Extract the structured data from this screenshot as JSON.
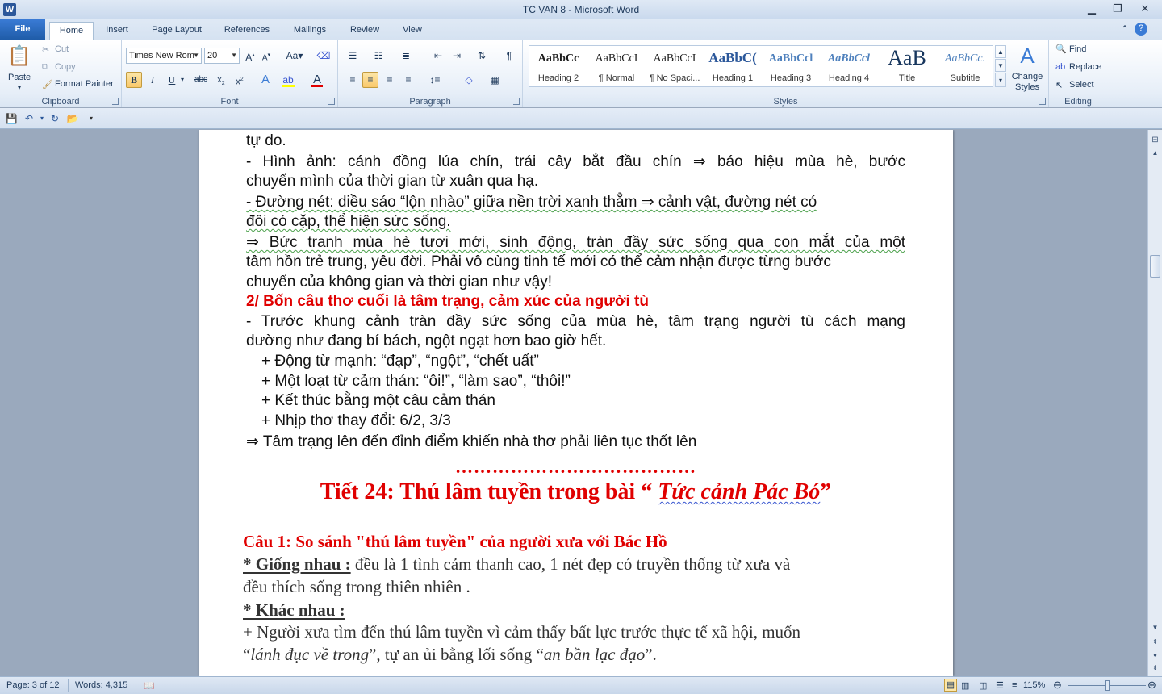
{
  "window": {
    "title": "TC VAN 8  -  Microsoft Word",
    "app_icon": "W",
    "controls": [
      "minimize-icon",
      "restore-icon",
      "close-icon"
    ]
  },
  "ribbon_tabs": [
    "File",
    "Home",
    "Insert",
    "Page Layout",
    "References",
    "Mailings",
    "Review",
    "View"
  ],
  "ribbon": {
    "clipboard": {
      "label": "Clipboard",
      "paste": "Paste",
      "cut": "Cut",
      "copy": "Copy",
      "format_painter": "Format Painter"
    },
    "font": {
      "label": "Font",
      "font_name": "Times New Rom",
      "font_size": "20"
    },
    "paragraph": {
      "label": "Paragraph"
    },
    "styles": {
      "label": "Styles",
      "items": [
        {
          "sample": "AaBbCc",
          "name": "Heading 2"
        },
        {
          "sample": "AaBbCcI",
          "name": "¶ Normal"
        },
        {
          "sample": "AaBbCcI",
          "name": "¶ No Spaci..."
        },
        {
          "sample": "AaBbC(",
          "name": "Heading 1"
        },
        {
          "sample": "AaBbCcl",
          "name": "Heading 3"
        },
        {
          "sample": "AaBbCcl",
          "name": "Heading 4"
        },
        {
          "sample": "AaB",
          "name": "Title"
        },
        {
          "sample": "AaBbCc.",
          "name": "Subtitle"
        }
      ],
      "change_styles": "Change Styles"
    },
    "editing": {
      "label": "Editing",
      "find": "Find",
      "replace": "Replace",
      "select": "Select"
    }
  },
  "document": {
    "lines": [
      "tự do.",
      "- Hình ảnh: cánh đồng lúa chín, trái cây bắt đầu chín ⇒ báo hiệu mùa hè, bước",
      "chuyển mình của thời gian từ xuân qua hạ.",
      "- Đường nét: diều sáo “lộn nhào” giữa nền trời xanh thẳm ⇒ cảnh vật, đường nét có",
      "đôi có cặp, thể hiện sức sống.",
      "⇒ Bức tranh mùa hè tươi mới, sinh động, tràn đầy sức sống qua con mắt của một",
      "tâm hồn trẻ trung, yêu đời. Phải vô cùng tinh tế mới có thể cảm nhận được từng bước",
      "chuyển của không gian và thời gian như vậy!",
      "2/ Bốn câu thơ cuối là tâm trạng, cảm xúc của người tù",
      "- Trước khung cảnh tràn đầy sức sống của mùa hè, tâm trạng người tù cách mạng",
      "dường như đang bí bách, ngột ngạt hơn bao giờ hết.",
      "+ Động từ mạnh: “đạp”, “ngột”, “chết uất”",
      "+ Một loạt từ cảm thán: “ôi!”, “làm sao”, “thôi!”",
      "+ Kết thúc bằng một câu cảm thán",
      "+ Nhịp thơ thay đổi: 6/2, 3/3",
      "⇒ Tâm trạng lên đến đỉnh điểm khiến nhà thơ phải liên tục thốt lên"
    ],
    "dots": "…………………………………",
    "lesson_title_prefix": "Tiết 24: Thú lâm tuyền trong bài “ ",
    "lesson_title_italic": "Tức cảnh Pác Bó",
    "lesson_title_suffix": "”",
    "question1": "Câu 1: So sánh \"thú lâm tuyền\" của người xưa với Bác Hồ",
    "same_label": "* Giống nhau :",
    "same_text": " đều là 1 tình cảm thanh cao, 1 nét đẹp có truyền thống từ xưa và",
    "same_text2": "đều thích sống trong thiên nhiên .",
    "diff_label": "* Khác nhau :",
    "diff_text1": "+ Người xưa tìm đến thú lâm tuyền vì cảm thấy bất lực trước thực tế xã hội, muốn",
    "diff_q1": "lánh đục về trong",
    "diff_mid": "”, tự an ủi bằng lối sống “",
    "diff_q2": "an bần lạc đạo",
    "diff_end": "”."
  },
  "statusbar": {
    "page": "Page: 3 of 12",
    "words": "Words: 4,315",
    "zoom": "115%",
    "zoom_level_percent": 115
  }
}
